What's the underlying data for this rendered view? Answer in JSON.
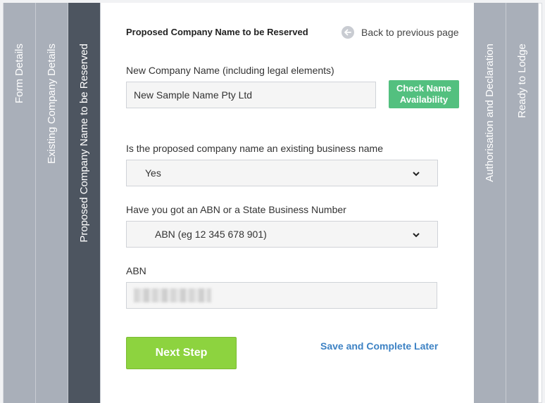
{
  "steps": [
    {
      "label": "Form Details"
    },
    {
      "label": "Existing Company Details"
    },
    {
      "label": "Proposed Company Name to be Reserved"
    },
    {
      "label": "Authorisation and Declaration"
    },
    {
      "label": "Ready to Lodge"
    }
  ],
  "header": {
    "title": "Proposed Company Name to be Reserved",
    "back_label": "Back to previous page"
  },
  "company_name": {
    "label": "New Company Name (including legal elements)",
    "value": "New Sample Name Pty Ltd",
    "check_button": "Check Name Availability"
  },
  "existing_business": {
    "label": "Is the proposed company name an existing business name",
    "selected": "Yes"
  },
  "abn_type": {
    "label": "Have you got an ABN or a State Business Number",
    "selected": "ABN (eg 12 345 678 901)"
  },
  "abn": {
    "label": "ABN"
  },
  "actions": {
    "next": "Next Step",
    "save_later": "Save and Complete Later"
  },
  "colors": {
    "active_step": "#4d5560",
    "inactive_step": "#a9afb9",
    "check_button": "#53c07f",
    "next_button": "#8dd33f",
    "link": "#3d82c4"
  }
}
